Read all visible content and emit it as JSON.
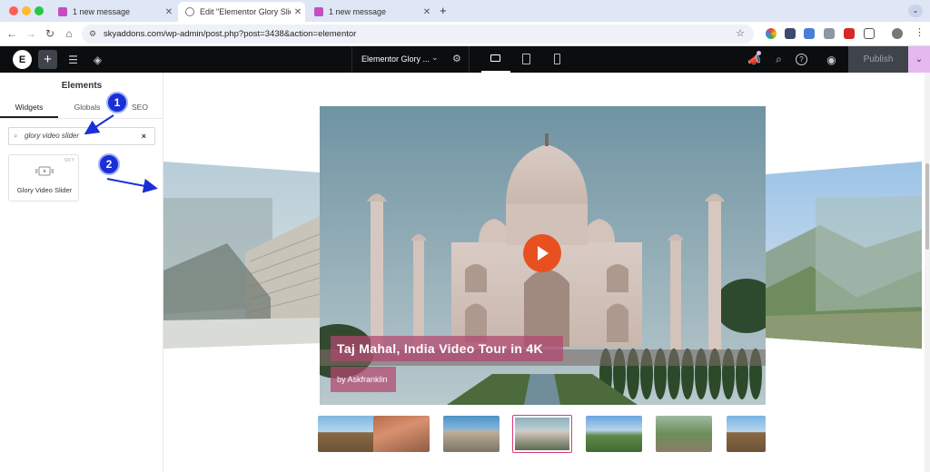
{
  "browser": {
    "tabs": [
      {
        "title": "1 new message",
        "active": false
      },
      {
        "title": "Edit \"Elementor Glory Slider W",
        "active": true
      },
      {
        "title": "1 new message",
        "active": false
      }
    ],
    "new_tab": "+",
    "url": "skyaddons.com/wp-admin/post.php?post=3438&action=elementor"
  },
  "editor": {
    "page_title": "Elementor Glory ...",
    "publish_label": "Publish"
  },
  "panel": {
    "title": "Elements",
    "tabs": [
      "Widgets",
      "Globals",
      "SEO"
    ],
    "search_value": "glory video slider",
    "widget_label": "Glory Video Slider",
    "widget_badge": "SKY"
  },
  "annotations": {
    "step1": "1",
    "step2": "2"
  },
  "slider": {
    "title": "Taj Mahal, India Video Tour in 4K",
    "byline": "by Askfranklin",
    "play_icon": "play-icon",
    "active_thumbnail": 4,
    "thumbnail_count": 7
  },
  "colors": {
    "accent_purple": "#e5b8f0",
    "annotation_blue": "#1a2fd6",
    "play_orange": "#e8511f",
    "title_overlay": "#b2466e"
  }
}
